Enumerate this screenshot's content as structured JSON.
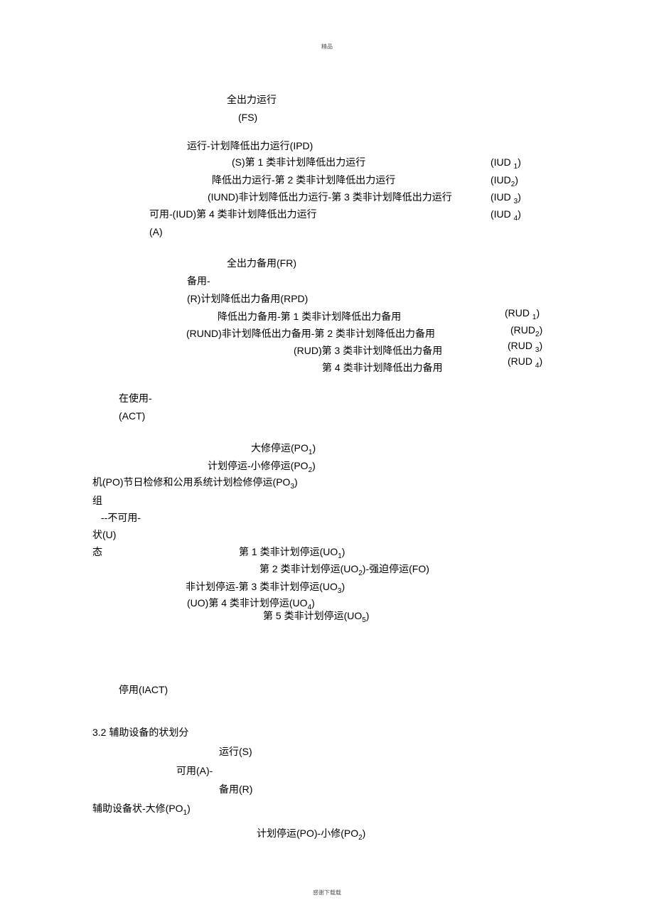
{
  "header_tiny": "精品",
  "footer_tiny": "感谢下载载",
  "fs_line1": "全出力运行",
  "fs_line2": "(FS)",
  "ipd_line": "运行-计划降低出力运行(IPD)",
  "s_line": "(S)第 1 类非计划降低出力运行",
  "iud1": "(IUD 1)",
  "deg2_line": "降低出力运行-第 2 类非计划降低出力运行",
  "iud2": "(IUD2)",
  "iund_line": "(IUND)非计划降低出力运行-第 3 类非计划降低出力运行",
  "iud3": "(IUD 3)",
  "a_iud_line": "可用-(IUD)第 4 类非计划降低出力运行",
  "iud4": "(IUD 4)",
  "a_line": "(A)",
  "fr_line": "全出力备用(FR)",
  "bp_line": "备用-",
  "rpd_line": "(R)计划降低出力备用(RPD)",
  "rud_deg_line": "降低出力备用-第 1 类非计划降低出力备用",
  "rud1": "(RUD 1)",
  "rund_line": "(RUND)非计划降低出力备用-第 2 类非计划降低出力备用",
  "rud2": "(RUD2)",
  "rud3_pre": "(RUD)第 3 类非计划降低出力备用",
  "rud3": "(RUD 3)",
  "rud4_pre": "第 4 类非计划降低出力备用",
  "rud4": "(RUD 4)",
  "inuse_line": "在使用-",
  "act_line": "(ACT)",
  "po1_line": "大修停运(PO1)",
  "po2_line": "计划停运-小修停运(PO2)",
  "po3_line": "机(PO)节日检修和公用系统计划检修停运(PO3)",
  "zu": "组",
  "na_line": "--不可用-",
  "zhuang": "状(U)",
  "tai": "态",
  "uo1_line": "第 1 类非计划停运(UO1)",
  "uo2_line": "第 2 类非计划停运(UO2)-强迫停运(FO)",
  "uo3_pre": "非计划停运-第 3 类非计划停运(UO3)",
  "uo4_line": "(UO)第 4 类非计划停运(UO4)",
  "uo5_line": "第 5 类非计划停运(UO5)",
  "iact_line": "停用(IACT)",
  "sec32_title": "3.2 辅助设备的状划分",
  "aux_run": "运行(S)",
  "aux_avail": "可用(A)-",
  "aux_reserve": "备用(R)",
  "aux_po1": "辅助设备状-大修(PO1)",
  "aux_po2": "计划停运(PO)-小修(PO2)"
}
